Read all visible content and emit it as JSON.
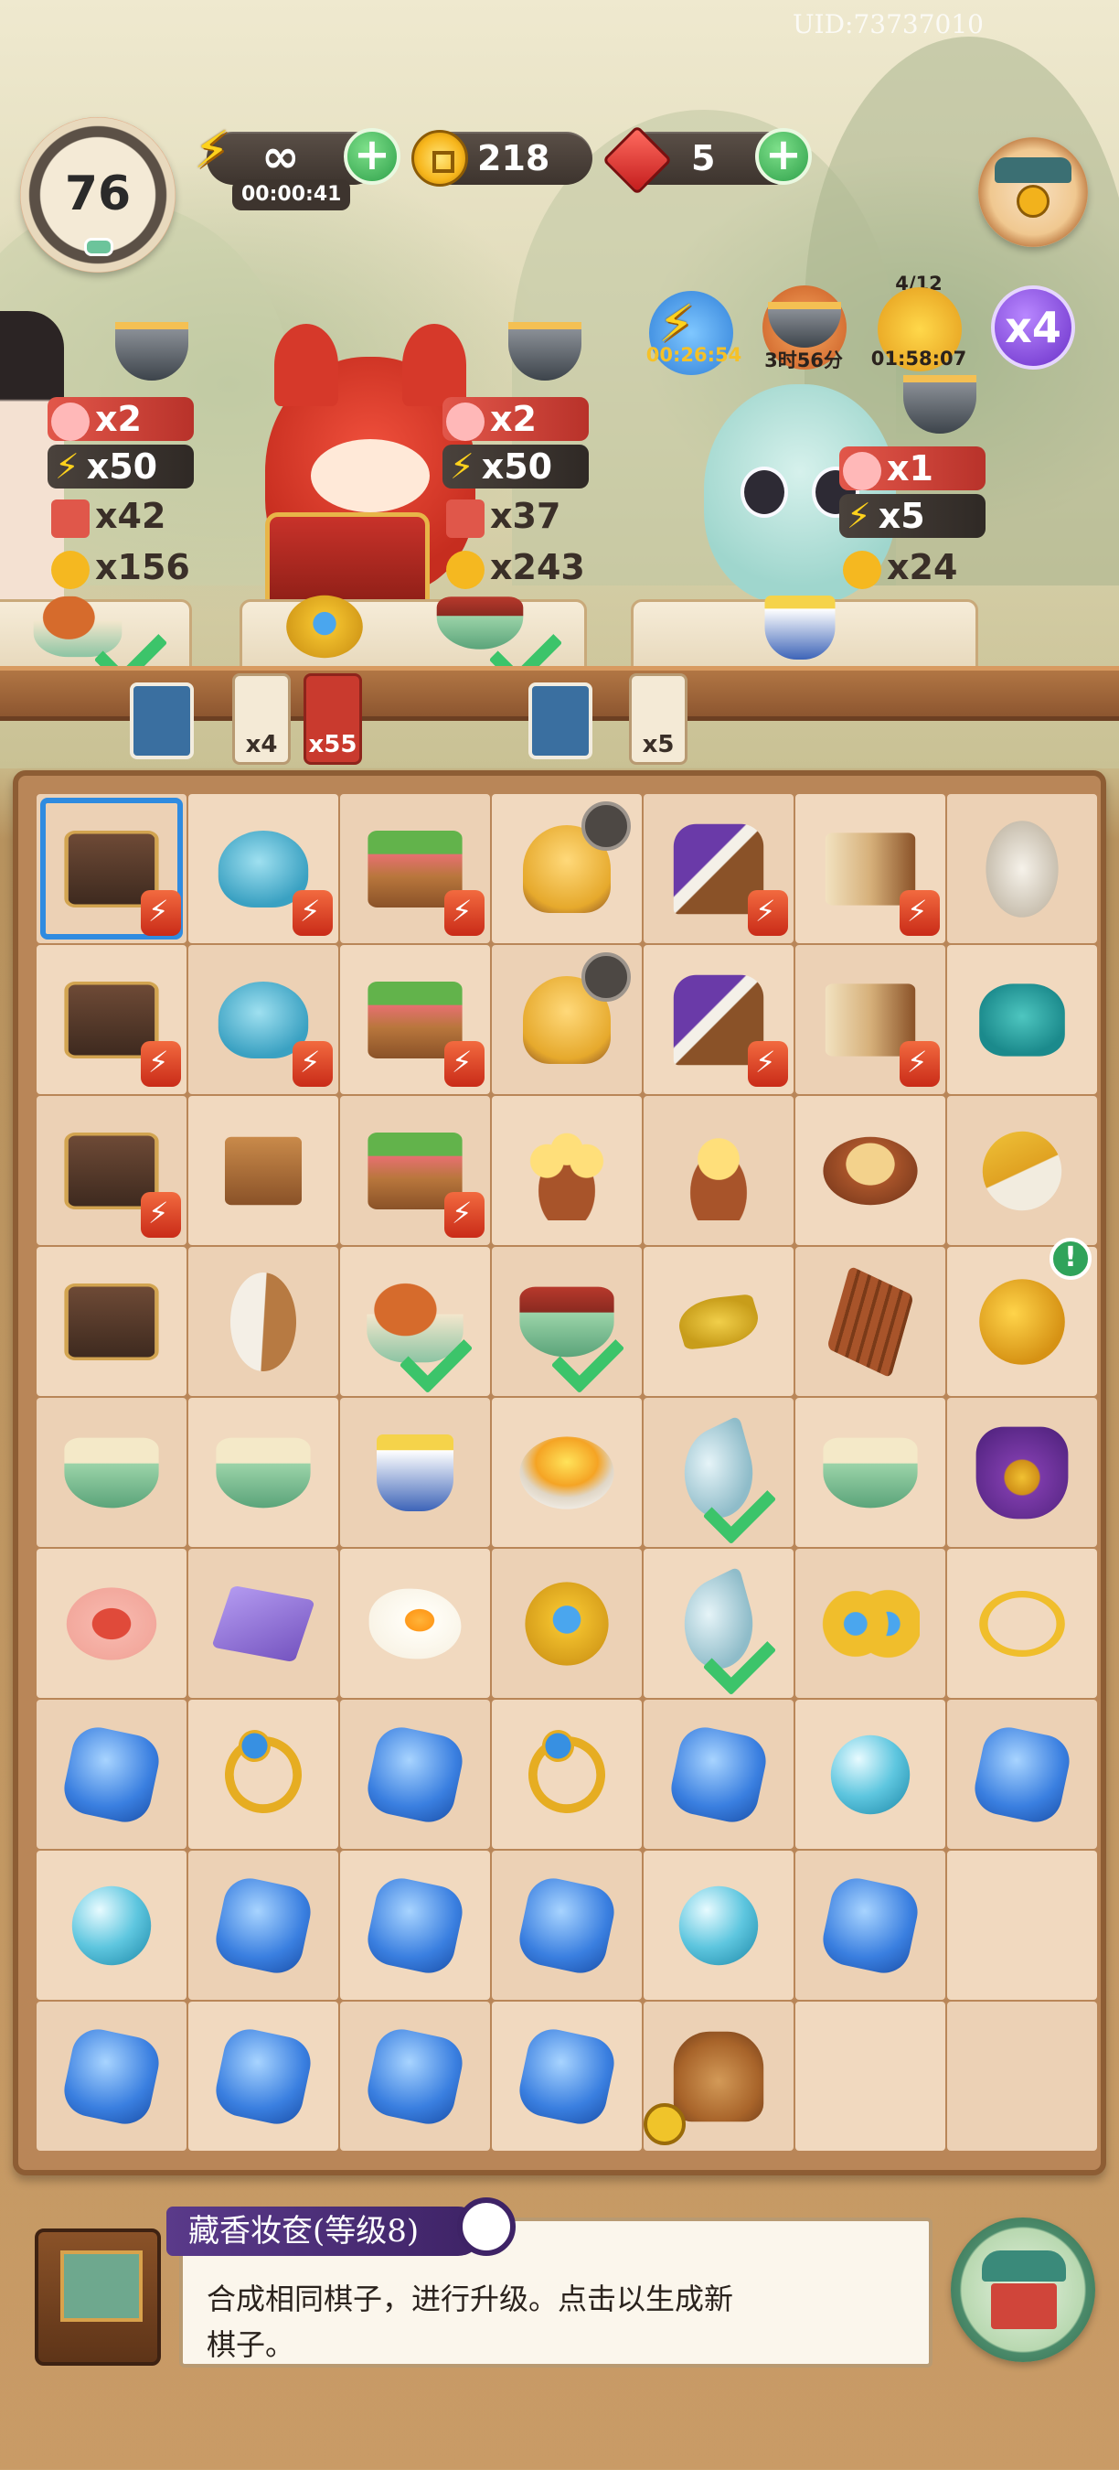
{
  "header": {
    "uid": "UID:73737010",
    "level": "76",
    "energy_value": "∞",
    "energy_timer": "00:00:41",
    "coins": "218",
    "gems": "5"
  },
  "events": {
    "boost_timer": "00:26:54",
    "pot_timer": "3时56分",
    "cat_progress": "4/12",
    "cat_timer": "01:58:07",
    "multiplier": "x4"
  },
  "customers": [
    {
      "reward_count": "x2",
      "energy": "x50",
      "cards": "x42",
      "coins": "x156"
    },
    {
      "reward_count": "x2",
      "energy": "x50",
      "cards": "x37",
      "coins": "x243"
    },
    {
      "reward_count": "x1",
      "energy": "x5",
      "coins": "x24"
    }
  ],
  "counter_tags": [
    "x4",
    "x55",
    "x5"
  ],
  "board": {
    "rows": [
      [
        "chest-energy",
        "teapot-energy",
        "basket-energy",
        "henhouse",
        "loom-energy",
        "scrolls-energy",
        "cocoons"
      ],
      [
        "chest-energy",
        "teapot-energy",
        "basket-energy",
        "hen-nest",
        "loom-energy",
        "scrolls-energy",
        "jar"
      ],
      [
        "chest-energy",
        "tea-box",
        "melon-basket-energy",
        "chicks-3",
        "chicks-1",
        "egg-nest",
        "brush"
      ],
      [
        "chest-closed",
        "spindle",
        "chicken-dish-done",
        "red-bean-soup-done",
        "leaves",
        "cinnamon",
        "coin-pouch"
      ],
      [
        "porridge",
        "sweet-soup",
        "teacup",
        "fried-rice",
        "jade-pendant-done",
        "green-porridge",
        "purple-pouch"
      ],
      [
        "mooncake",
        "purple-scroll",
        "fried-egg",
        "gold-hairpin",
        "jade-pendant-done",
        "gold-flowers",
        "bracelet"
      ],
      [
        "blue-gem",
        "gold-ring",
        "blue-gem",
        "gold-ring",
        "blue-gem",
        "pearl",
        "blue-gem"
      ],
      [
        "pearl",
        "blue-gem",
        "blue-gem",
        "blue-gem",
        "pearl",
        "blue-gem",
        "empty"
      ],
      [
        "blue-gem",
        "blue-gem",
        "blue-gem",
        "blue-gem",
        "censer",
        "empty",
        "empty"
      ]
    ]
  },
  "info": {
    "title": "藏香妆奁(等级8)",
    "line1": "合成相同棋子，进行升级。点击以生成新",
    "line2": "棋子。"
  },
  "colors": {
    "accent_green": "#3cc46a",
    "energy_red": "#c92b18",
    "selection_blue": "#2f8be0",
    "title_purple": "#3e2366"
  }
}
